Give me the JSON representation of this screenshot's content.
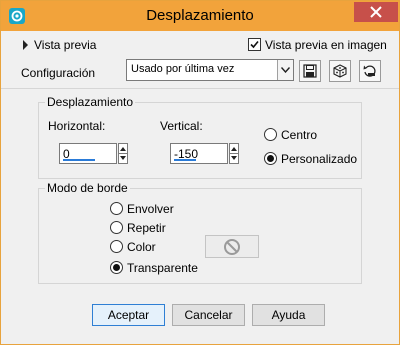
{
  "window": {
    "title": "Desplazamiento"
  },
  "preview": {
    "toggle_label": "Vista previa",
    "in_image_label": "Vista previa en imagen",
    "in_image_checked": true
  },
  "config": {
    "label": "Configuración",
    "value": "Usado por última vez"
  },
  "offset": {
    "title": "Desplazamiento",
    "horizontal_label": "Horizontal:",
    "horizontal_value": "0",
    "vertical_label": "Vertical:",
    "vertical_value": "-150",
    "options": [
      {
        "label": "Centro",
        "selected": false
      },
      {
        "label": "Personalizado",
        "selected": true
      }
    ]
  },
  "edge": {
    "title": "Modo de borde",
    "options": [
      {
        "label": "Envolver",
        "selected": false
      },
      {
        "label": "Repetir",
        "selected": false
      },
      {
        "label": "Color",
        "selected": false
      },
      {
        "label": "Transparente",
        "selected": true
      }
    ]
  },
  "buttons": {
    "ok": "Aceptar",
    "cancel": "Cancelar",
    "help": "Ayuda"
  },
  "colors": {
    "titlebar": "#f2a33b",
    "close": "#c7504a",
    "accent": "#2a7bd8",
    "window_bg": "#f0f0f0"
  }
}
